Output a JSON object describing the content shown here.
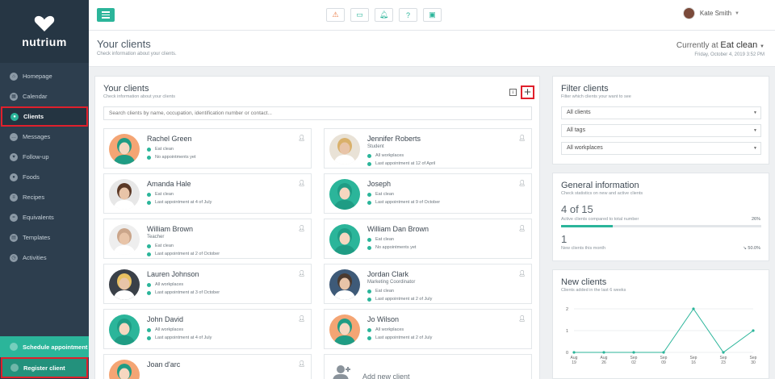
{
  "app": {
    "logo_text": "nutrium"
  },
  "sidebar": {
    "items": [
      {
        "label": "Homepage",
        "icon": "home-icon"
      },
      {
        "label": "Calendar",
        "icon": "calendar-icon"
      },
      {
        "label": "Clients",
        "icon": "users-icon",
        "active": true
      },
      {
        "label": "Messages",
        "icon": "chat-icon"
      },
      {
        "label": "Follow-up",
        "icon": "heart-icon"
      },
      {
        "label": "Foods",
        "icon": "apple-icon"
      },
      {
        "label": "Recipes",
        "icon": "recipe-icon"
      },
      {
        "label": "Equivalents",
        "icon": "scale-icon"
      },
      {
        "label": "Templates",
        "icon": "template-icon"
      },
      {
        "label": "Activities",
        "icon": "activity-icon"
      }
    ],
    "schedule_label": "Schedule appointment",
    "register_label": "Register client"
  },
  "topbar": {
    "user_name": "Kate Smith"
  },
  "header": {
    "title": "Your clients",
    "subtitle": "Check information about your clients.",
    "current_prefix": "Currently at",
    "current_place": "Eat clean",
    "date": "Friday, October 4, 2019 3:52 PM"
  },
  "clients": {
    "title": "Your clients",
    "subtitle": "Check information about your clients",
    "search_placeholder": "Search clients by name, occupation, identification number or contact...",
    "add_label": "Add new client",
    "list": [
      {
        "name": "Rachel Green",
        "occupation": "",
        "workplace": "Eat clean",
        "appointment": "No appointments yet",
        "avatar": "female-green-avatar"
      },
      {
        "name": "Jennifer Roberts",
        "occupation": "Student",
        "workplace": "All workplaces",
        "appointment": "Last appointment at 12 of April",
        "avatar": "photo-blonde-avatar"
      },
      {
        "name": "Amanda Hale",
        "occupation": "",
        "workplace": "Eat clean",
        "appointment": "Last appointment at 4 of July",
        "avatar": "photo-brunette-avatar"
      },
      {
        "name": "Joseph",
        "occupation": "",
        "workplace": "Eat clean",
        "appointment": "Last appointment at 9 of October",
        "avatar": "male-green-avatar"
      },
      {
        "name": "William Brown",
        "occupation": "Teacher",
        "workplace": "Eat clean",
        "appointment": "Last appointment at 2 of October",
        "avatar": "photo-bald-man-avatar"
      },
      {
        "name": "William Dan Brown",
        "occupation": "",
        "workplace": "Eat clean",
        "appointment": "No appointments yet",
        "avatar": "male-green-avatar"
      },
      {
        "name": "Lauren Johnson",
        "occupation": "",
        "workplace": "All workplaces",
        "appointment": "Last appointment at 3 of October",
        "avatar": "photo-curly-avatar"
      },
      {
        "name": "Jordan Clark",
        "occupation": "Marketing Coordinator",
        "workplace": "Eat clean",
        "appointment": "Last appointment at 2 of July",
        "avatar": "photo-man-avatar"
      },
      {
        "name": "John David",
        "occupation": "",
        "workplace": "All workplaces",
        "appointment": "Last appointment at 4 of July",
        "avatar": "male-green-avatar"
      },
      {
        "name": "Jo Wilson",
        "occupation": "",
        "workplace": "All workplaces",
        "appointment": "Last appointment at 2 of July",
        "avatar": "female-orange-avatar"
      },
      {
        "name": "Joan d'arc",
        "occupation": "",
        "workplace": "",
        "appointment": "",
        "avatar": "female-orange-avatar"
      }
    ]
  },
  "filter": {
    "title": "Filter clients",
    "subtitle": "Filter which clients your want to see",
    "selects": [
      "All clients",
      "All tags",
      "All workplaces"
    ]
  },
  "general": {
    "title": "General information",
    "subtitle": "Check statistics on new and active clients",
    "active_value": "4 of 15",
    "active_label": "Active clients compared to total number",
    "active_pct_label": "26%",
    "active_fraction": 0.26,
    "new_value": "1",
    "new_label": "New clients this month",
    "new_change": "50.0%"
  },
  "new_clients": {
    "title": "New clients",
    "subtitle": "Clients added in the last 6 weeks"
  },
  "chart_data": {
    "type": "line",
    "categories": [
      "Aug 19",
      "Aug 26",
      "Sep 02",
      "Sep 09",
      "Sep 16",
      "Sep 23",
      "Sep 30"
    ],
    "series": [
      {
        "values": [
          0,
          0,
          0,
          0,
          2,
          0,
          1
        ]
      }
    ],
    "ylim": [
      0,
      2
    ],
    "yticks": [
      0,
      1,
      2
    ],
    "color": "#2bb59a",
    "grid": true
  },
  "colors": {
    "accent": "#2bb59a",
    "sidebar": "#2d3e4e",
    "highlight": "#e0202c"
  }
}
